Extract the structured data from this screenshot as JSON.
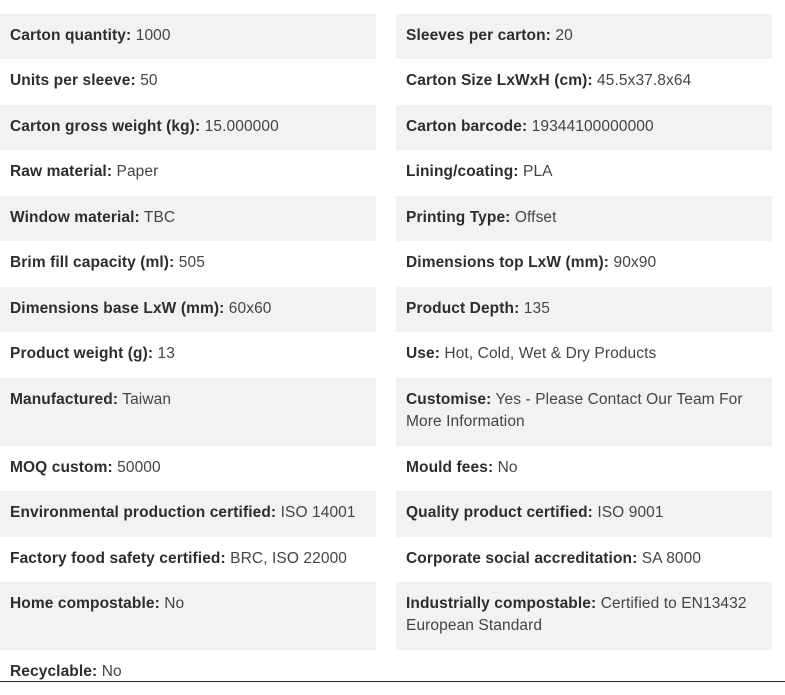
{
  "rows": [
    {
      "left": {
        "label": "Carton quantity:",
        "value": "1000"
      },
      "right": {
        "label": "Sleeves per carton:",
        "value": "20"
      }
    },
    {
      "left": {
        "label": "Units per sleeve:",
        "value": "50"
      },
      "right": {
        "label": "Carton Size LxWxH (cm):",
        "value": "45.5x37.8x64"
      }
    },
    {
      "left": {
        "label": "Carton gross weight (kg):",
        "value": "15.000000"
      },
      "right": {
        "label": "Carton barcode:",
        "value": "19344100000000"
      }
    },
    {
      "left": {
        "label": "Raw material:",
        "value": "Paper"
      },
      "right": {
        "label": "Lining/coating:",
        "value": "PLA"
      }
    },
    {
      "left": {
        "label": "Window material:",
        "value": "TBC"
      },
      "right": {
        "label": "Printing Type:",
        "value": "Offset"
      }
    },
    {
      "left": {
        "label": "Brim fill capacity (ml):",
        "value": "505"
      },
      "right": {
        "label": "Dimensions top LxW (mm):",
        "value": "90x90"
      }
    },
    {
      "left": {
        "label": "Dimensions base LxW (mm):",
        "value": "60x60"
      },
      "right": {
        "label": "Product Depth:",
        "value": "135"
      }
    },
    {
      "left": {
        "label": "Product weight (g):",
        "value": "13"
      },
      "right": {
        "label": "Use:",
        "value": "Hot, Cold, Wet & Dry Products"
      }
    },
    {
      "left": {
        "label": "Manufactured:",
        "value": "Taiwan"
      },
      "right": {
        "label": "Customise:",
        "value": "Yes - Please Contact Our Team For More Information"
      }
    },
    {
      "left": {
        "label": "MOQ custom:",
        "value": "50000"
      },
      "right": {
        "label": "Mould fees:",
        "value": "No"
      }
    },
    {
      "left": {
        "label": "Environmental production certified:",
        "value": "ISO 14001"
      },
      "right": {
        "label": "Quality product certified:",
        "value": "ISO 9001"
      }
    },
    {
      "left": {
        "label": "Factory food safety certified:",
        "value": "BRC, ISO 22000"
      },
      "right": {
        "label": "Corporate social accreditation:",
        "value": "SA 8000"
      }
    },
    {
      "left": {
        "label": "Home compostable:",
        "value": "No"
      },
      "right": {
        "label": "Industrially compostable:",
        "value": "Certified to EN13432 European Standard"
      }
    },
    {
      "left": {
        "label": "Recyclable:",
        "value": "No"
      },
      "right": {
        "label": "",
        "value": ""
      }
    }
  ]
}
